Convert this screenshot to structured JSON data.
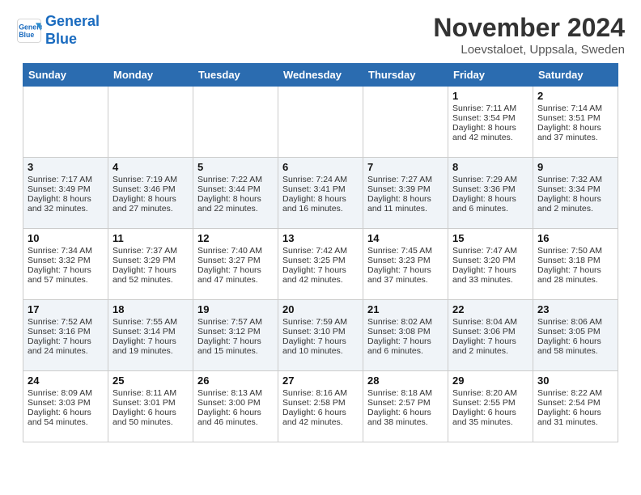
{
  "header": {
    "logo_line1": "General",
    "logo_line2": "Blue",
    "month_year": "November 2024",
    "location": "Loevstaloet, Uppsala, Sweden"
  },
  "weekdays": [
    "Sunday",
    "Monday",
    "Tuesday",
    "Wednesday",
    "Thursday",
    "Friday",
    "Saturday"
  ],
  "weeks": [
    [
      {
        "day": "",
        "info": ""
      },
      {
        "day": "",
        "info": ""
      },
      {
        "day": "",
        "info": ""
      },
      {
        "day": "",
        "info": ""
      },
      {
        "day": "",
        "info": ""
      },
      {
        "day": "1",
        "info": "Sunrise: 7:11 AM\nSunset: 3:54 PM\nDaylight: 8 hours and 42 minutes."
      },
      {
        "day": "2",
        "info": "Sunrise: 7:14 AM\nSunset: 3:51 PM\nDaylight: 8 hours and 37 minutes."
      }
    ],
    [
      {
        "day": "3",
        "info": "Sunrise: 7:17 AM\nSunset: 3:49 PM\nDaylight: 8 hours and 32 minutes."
      },
      {
        "day": "4",
        "info": "Sunrise: 7:19 AM\nSunset: 3:46 PM\nDaylight: 8 hours and 27 minutes."
      },
      {
        "day": "5",
        "info": "Sunrise: 7:22 AM\nSunset: 3:44 PM\nDaylight: 8 hours and 22 minutes."
      },
      {
        "day": "6",
        "info": "Sunrise: 7:24 AM\nSunset: 3:41 PM\nDaylight: 8 hours and 16 minutes."
      },
      {
        "day": "7",
        "info": "Sunrise: 7:27 AM\nSunset: 3:39 PM\nDaylight: 8 hours and 11 minutes."
      },
      {
        "day": "8",
        "info": "Sunrise: 7:29 AM\nSunset: 3:36 PM\nDaylight: 8 hours and 6 minutes."
      },
      {
        "day": "9",
        "info": "Sunrise: 7:32 AM\nSunset: 3:34 PM\nDaylight: 8 hours and 2 minutes."
      }
    ],
    [
      {
        "day": "10",
        "info": "Sunrise: 7:34 AM\nSunset: 3:32 PM\nDaylight: 7 hours and 57 minutes."
      },
      {
        "day": "11",
        "info": "Sunrise: 7:37 AM\nSunset: 3:29 PM\nDaylight: 7 hours and 52 minutes."
      },
      {
        "day": "12",
        "info": "Sunrise: 7:40 AM\nSunset: 3:27 PM\nDaylight: 7 hours and 47 minutes."
      },
      {
        "day": "13",
        "info": "Sunrise: 7:42 AM\nSunset: 3:25 PM\nDaylight: 7 hours and 42 minutes."
      },
      {
        "day": "14",
        "info": "Sunrise: 7:45 AM\nSunset: 3:23 PM\nDaylight: 7 hours and 37 minutes."
      },
      {
        "day": "15",
        "info": "Sunrise: 7:47 AM\nSunset: 3:20 PM\nDaylight: 7 hours and 33 minutes."
      },
      {
        "day": "16",
        "info": "Sunrise: 7:50 AM\nSunset: 3:18 PM\nDaylight: 7 hours and 28 minutes."
      }
    ],
    [
      {
        "day": "17",
        "info": "Sunrise: 7:52 AM\nSunset: 3:16 PM\nDaylight: 7 hours and 24 minutes."
      },
      {
        "day": "18",
        "info": "Sunrise: 7:55 AM\nSunset: 3:14 PM\nDaylight: 7 hours and 19 minutes."
      },
      {
        "day": "19",
        "info": "Sunrise: 7:57 AM\nSunset: 3:12 PM\nDaylight: 7 hours and 15 minutes."
      },
      {
        "day": "20",
        "info": "Sunrise: 7:59 AM\nSunset: 3:10 PM\nDaylight: 7 hours and 10 minutes."
      },
      {
        "day": "21",
        "info": "Sunrise: 8:02 AM\nSunset: 3:08 PM\nDaylight: 7 hours and 6 minutes."
      },
      {
        "day": "22",
        "info": "Sunrise: 8:04 AM\nSunset: 3:06 PM\nDaylight: 7 hours and 2 minutes."
      },
      {
        "day": "23",
        "info": "Sunrise: 8:06 AM\nSunset: 3:05 PM\nDaylight: 6 hours and 58 minutes."
      }
    ],
    [
      {
        "day": "24",
        "info": "Sunrise: 8:09 AM\nSunset: 3:03 PM\nDaylight: 6 hours and 54 minutes."
      },
      {
        "day": "25",
        "info": "Sunrise: 8:11 AM\nSunset: 3:01 PM\nDaylight: 6 hours and 50 minutes."
      },
      {
        "day": "26",
        "info": "Sunrise: 8:13 AM\nSunset: 3:00 PM\nDaylight: 6 hours and 46 minutes."
      },
      {
        "day": "27",
        "info": "Sunrise: 8:16 AM\nSunset: 2:58 PM\nDaylight: 6 hours and 42 minutes."
      },
      {
        "day": "28",
        "info": "Sunrise: 8:18 AM\nSunset: 2:57 PM\nDaylight: 6 hours and 38 minutes."
      },
      {
        "day": "29",
        "info": "Sunrise: 8:20 AM\nSunset: 2:55 PM\nDaylight: 6 hours and 35 minutes."
      },
      {
        "day": "30",
        "info": "Sunrise: 8:22 AM\nSunset: 2:54 PM\nDaylight: 6 hours and 31 minutes."
      }
    ]
  ]
}
